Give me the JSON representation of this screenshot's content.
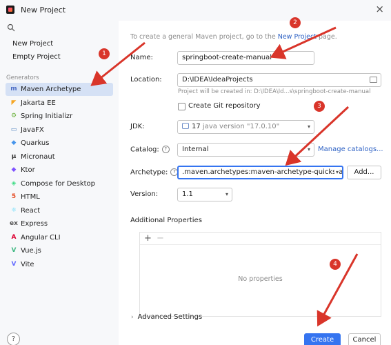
{
  "window": {
    "title": "New Project",
    "close_glyph": "×"
  },
  "sidebar": {
    "top_items": [
      {
        "label": "New Project"
      },
      {
        "label": "Empty Project"
      }
    ],
    "generators_header": "Generators",
    "generators": [
      {
        "label": "Maven Archetype",
        "icon": "m-icon",
        "color": "#4b6cc5",
        "glyph": "m"
      },
      {
        "label": "Jakarta EE",
        "icon": "jakarta-icon",
        "color": "#f5a623",
        "glyph": "◤"
      },
      {
        "label": "Spring Initializr",
        "icon": "spring-icon",
        "color": "#6db33f",
        "glyph": "⚙"
      },
      {
        "label": "JavaFX",
        "icon": "javafx-icon",
        "color": "#4a7ebb",
        "glyph": "▭"
      },
      {
        "label": "Quarkus",
        "icon": "quarkus-icon",
        "color": "#4695eb",
        "glyph": "◆"
      },
      {
        "label": "Micronaut",
        "icon": "micronaut-icon",
        "color": "#333333",
        "glyph": "μ"
      },
      {
        "label": "Ktor",
        "icon": "ktor-icon",
        "color": "#7f52ff",
        "glyph": "◆"
      },
      {
        "label": "Compose for Desktop",
        "icon": "compose-icon",
        "color": "#3ddc84",
        "glyph": "◈"
      },
      {
        "label": "HTML",
        "icon": "html-icon",
        "color": "#e44d26",
        "glyph": "5"
      },
      {
        "label": "React",
        "icon": "react-icon",
        "color": "#61dafb",
        "glyph": "⚛"
      },
      {
        "label": "Express",
        "icon": "express-icon",
        "color": "#555555",
        "glyph": "ex"
      },
      {
        "label": "Angular CLI",
        "icon": "angular-icon",
        "color": "#dd0031",
        "glyph": "A"
      },
      {
        "label": "Vue.js",
        "icon": "vue-icon",
        "color": "#41b883",
        "glyph": "V"
      },
      {
        "label": "Vite",
        "icon": "vite-icon",
        "color": "#646cff",
        "glyph": "V"
      }
    ]
  },
  "main": {
    "hint_prefix": "To create a general Maven project, go to the ",
    "hint_link": "New Project",
    "hint_suffix": " page.",
    "name_label": "Name:",
    "name_value": "springboot-create-manual",
    "location_label": "Location:",
    "location_value": "D:\\IDEA\\IdeaProjects",
    "location_hint": "Project will be created in: D:\\IDEA\\Id...s\\springboot-create-manual",
    "git_label": "Create Git repository",
    "jdk_label": "JDK:",
    "jdk_version": "17",
    "jdk_detail": "java version \"17.0.10\"",
    "catalog_label": "Catalog:",
    "catalog_value": "Internal",
    "manage_catalogs": "Manage catalogs...",
    "archetype_label": "Archetype:",
    "archetype_value": ".maven.archetypes:maven-archetype-quickstart",
    "add_button": "Add...",
    "version_label": "Version:",
    "version_value": "1.1",
    "additional_props": "Additional Properties",
    "plus": "+",
    "minus": "−",
    "no_props": "No properties",
    "advanced": "Advanced Settings",
    "advanced_chevron": "›",
    "help_q": "?"
  },
  "footer": {
    "create": "Create",
    "cancel": "Cancel",
    "help": "?"
  },
  "annotations": {
    "markers": [
      {
        "label": "1"
      },
      {
        "label": "2"
      },
      {
        "label": "3"
      },
      {
        "label": "4"
      }
    ],
    "color": "#d9352a"
  }
}
